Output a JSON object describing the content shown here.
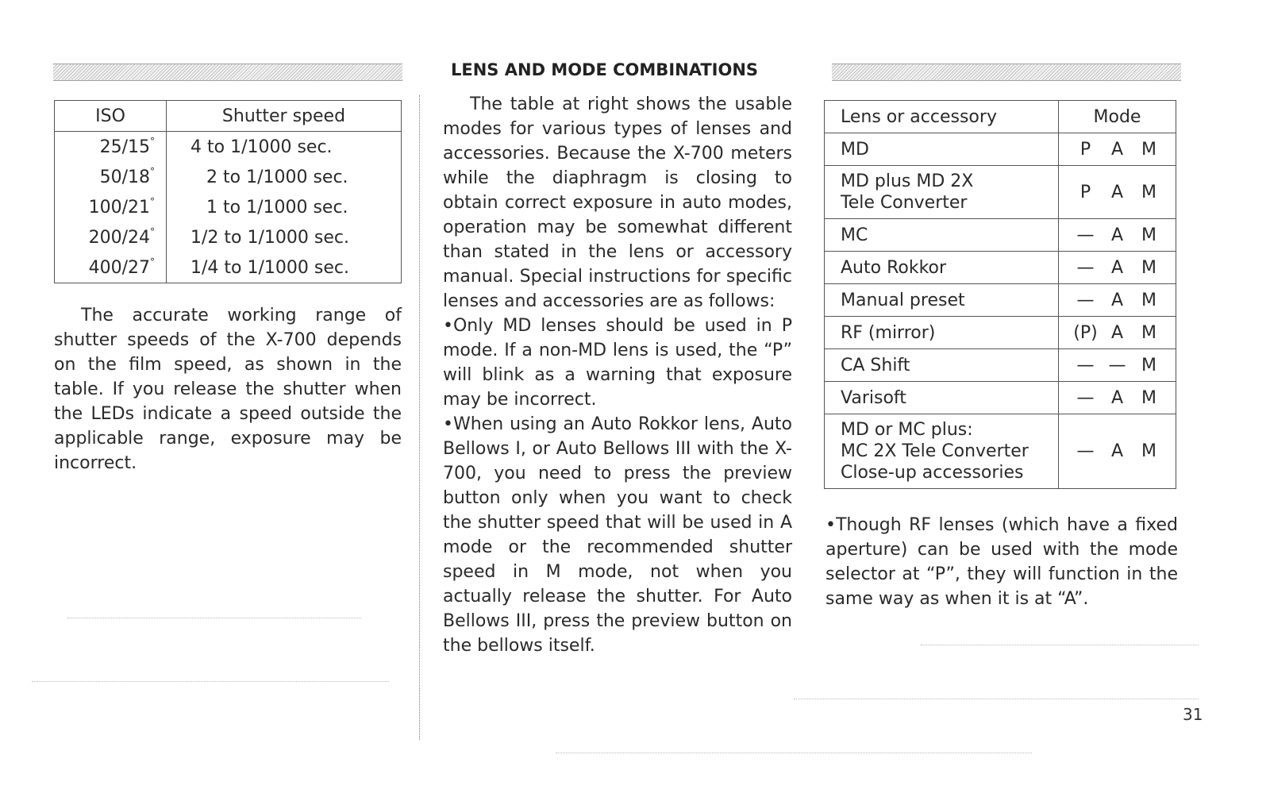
{
  "page": {
    "section_title": "LENS AND MODE COMBINATIONS",
    "page_number": "31"
  },
  "iso_table": {
    "headers": [
      "ISO",
      "Shutter speed"
    ],
    "rows": [
      {
        "iso": "25/15",
        "degree": "°",
        "speed": "4 to 1/1000 sec."
      },
      {
        "iso": "50/18",
        "degree": "°",
        "speed": "2 to 1/1000 sec."
      },
      {
        "iso": "100/21",
        "degree": "°",
        "speed": "1 to 1/1000 sec."
      },
      {
        "iso": "200/24",
        "degree": "°",
        "speed": "1/2 to 1/1000 sec."
      },
      {
        "iso": "400/27",
        "degree": "°",
        "speed": "1/4 to 1/1000 sec."
      }
    ]
  },
  "left_column": {
    "paragraph": "The accurate working range of shutter speeds of the X-700 depends on the film speed, as shown in the table. If you release the shutter when the LEDs indicate a speed outside the applicable range, exposure may be incorrect."
  },
  "middle_column": {
    "intro": "The table at right shows the usable modes for various types of lenses and accessories. Because the X-700 meters while the diaphragm is closing to obtain correct exposure in auto modes, operation may be somewhat different than stated in the lens or accessory manual. Special instructions for specific lenses and accessories are as follows:",
    "bullets": [
      "Only MD lenses should be used in P mode. If a non-MD lens is used, the “P” will blink as a warning that exposure may be incorrect.",
      "When using an Auto Rokkor lens, Auto Bellows I, or Auto Bellows III with the X-700, you need to press the preview button only when you want to check the shutter speed that will be used in A mode or the recommended shutter speed in M mode, not when you actually release the shutter. For Auto Bellows III, press the preview button on the bellows itself."
    ]
  },
  "mode_table": {
    "headers": [
      "Lens or accessory",
      "Mode"
    ],
    "rows": [
      {
        "lens": [
          "MD"
        ],
        "p": "P",
        "a": "A",
        "m": "M"
      },
      {
        "lens": [
          "MD plus MD 2X",
          "Tele Converter"
        ],
        "p": "P",
        "a": "A",
        "m": "M"
      },
      {
        "lens": [
          "MC"
        ],
        "p": "—",
        "a": "A",
        "m": "M"
      },
      {
        "lens": [
          "Auto Rokkor"
        ],
        "p": "—",
        "a": "A",
        "m": "M"
      },
      {
        "lens": [
          "Manual preset"
        ],
        "p": "—",
        "a": "A",
        "m": "M"
      },
      {
        "lens": [
          "RF (mirror)"
        ],
        "p": "(P)",
        "a": "A",
        "m": "M"
      },
      {
        "lens": [
          "CA Shift"
        ],
        "p": "—",
        "a": "—",
        "m": "M"
      },
      {
        "lens": [
          "Varisoft"
        ],
        "p": "—",
        "a": "A",
        "m": "M"
      },
      {
        "lens": [
          "MD or MC plus:",
          "MC 2X Tele Converter",
          "Close-up accessories"
        ],
        "p": "—",
        "a": "A",
        "m": "M"
      }
    ]
  },
  "right_column": {
    "bullet": "Though RF lenses (which have a fixed aperture) can be used with the mode selector at “P”, they will function in the same way as when it is at “A”."
  }
}
